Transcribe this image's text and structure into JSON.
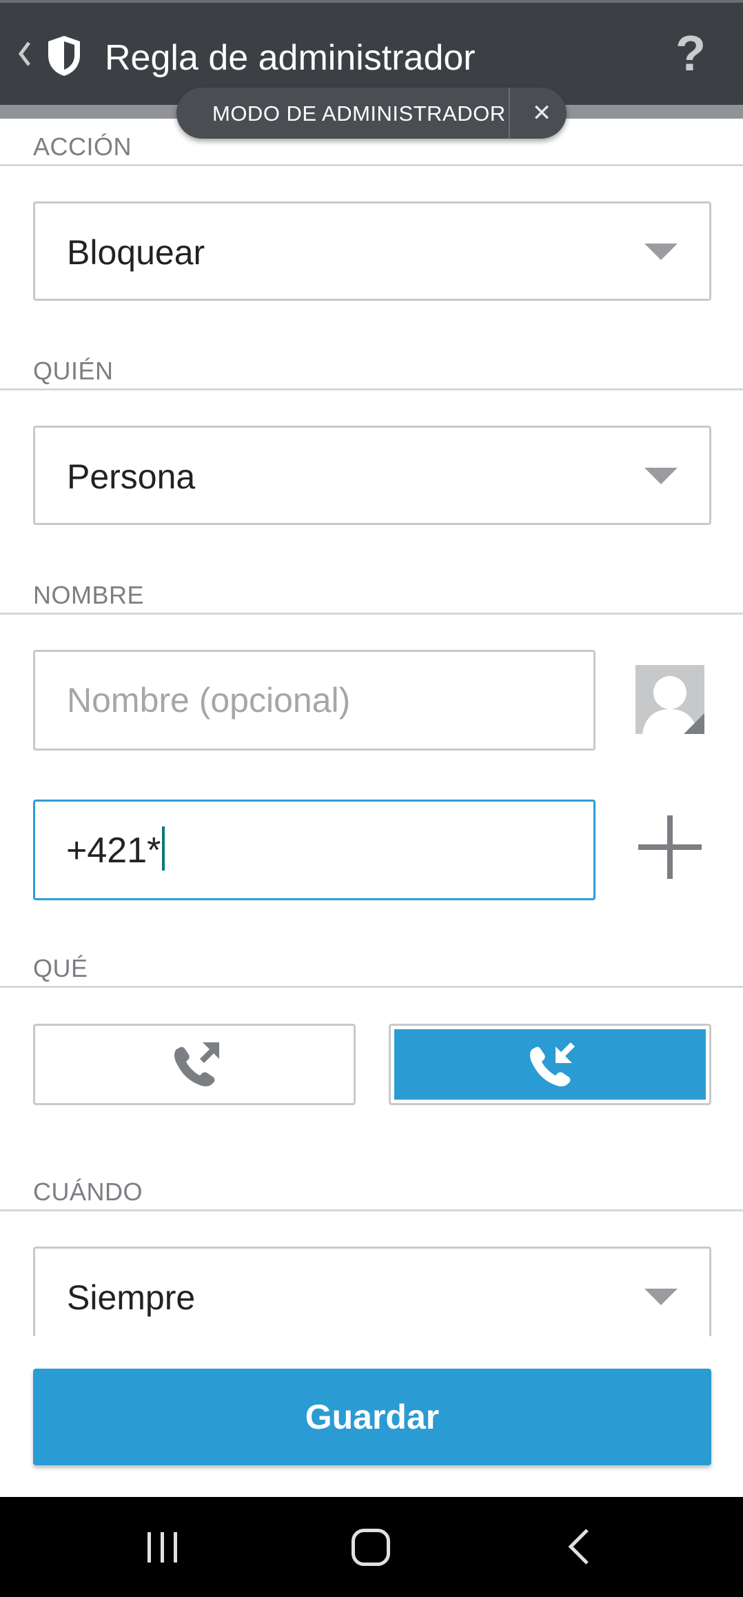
{
  "appbar": {
    "title": "Regla de administrador",
    "help_label": "?"
  },
  "admin_mode": {
    "label": "MODO DE ADMINISTRADOR",
    "close_label": "✕"
  },
  "sections": {
    "action": {
      "label": "ACCIÓN",
      "value": "Bloquear"
    },
    "who": {
      "label": "QUIÉN",
      "value": "Persona"
    },
    "name": {
      "label": "NOMBRE",
      "name_placeholder": "Nombre (opcional)",
      "name_value": "",
      "number_value": "+421*"
    },
    "what": {
      "label": "QUÉ",
      "options": [
        {
          "icon": "outgoing-call-icon",
          "selected": false
        },
        {
          "icon": "incoming-call-icon",
          "selected": true
        }
      ]
    },
    "when": {
      "label": "CUÁNDO",
      "value": "Siempre"
    }
  },
  "save_button": {
    "label": "Guardar"
  },
  "colors": {
    "appbar": "#3c3f44",
    "accent": "#2b9bd4",
    "section_label": "#7b7e82"
  }
}
